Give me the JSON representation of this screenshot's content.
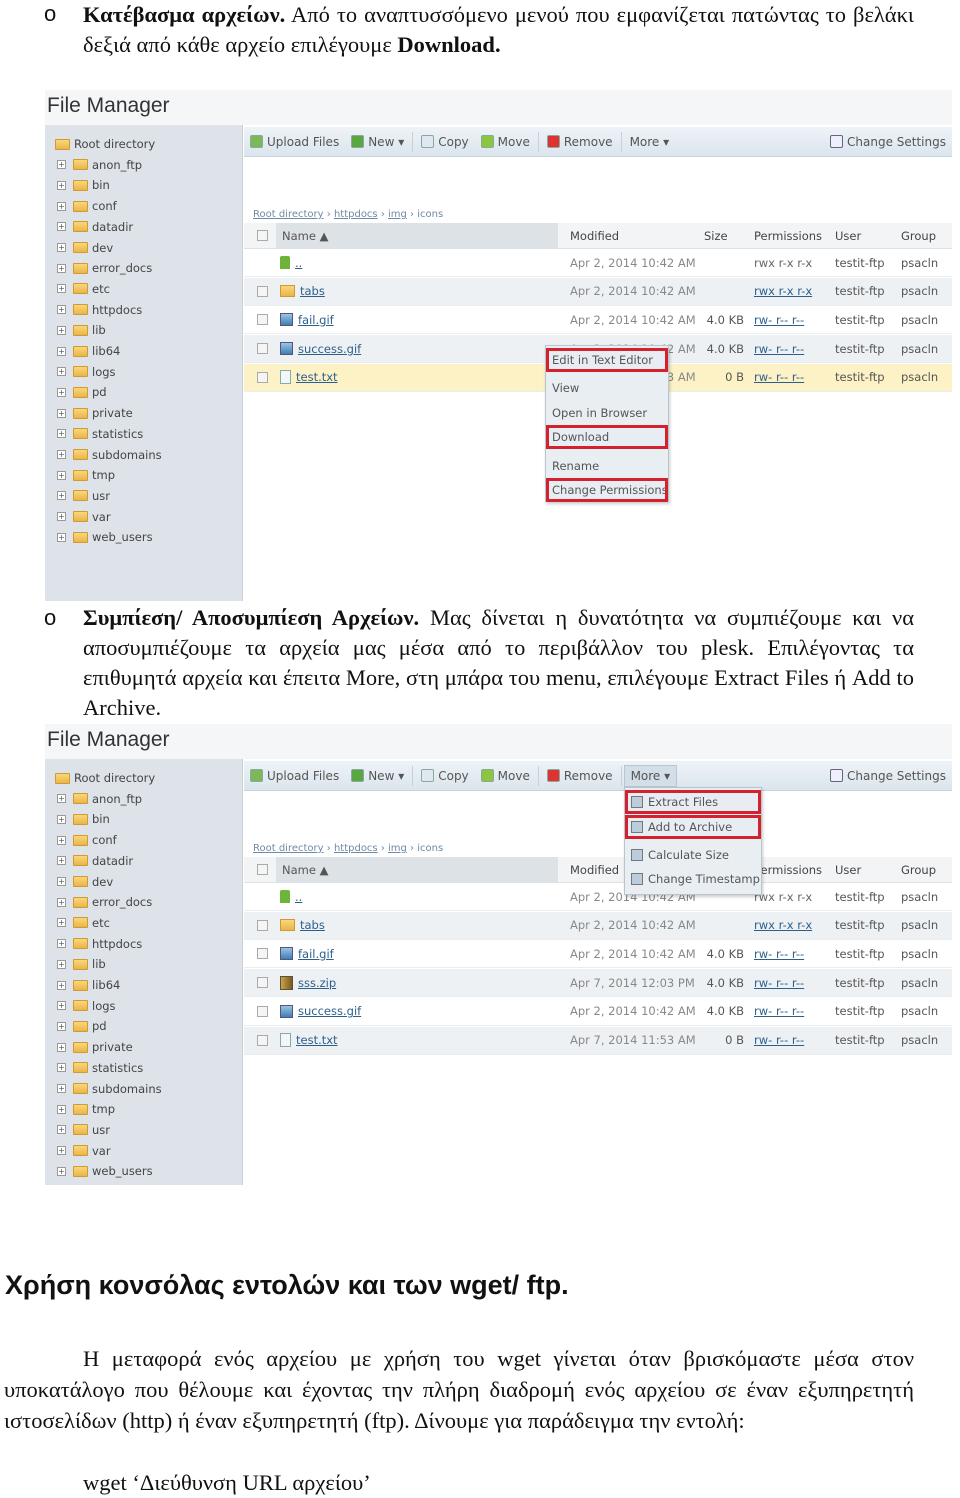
{
  "section1": {
    "bullet": "o",
    "title": "Κατέβασμα αρχείων.",
    "text": " Από το αναπτυσσόμενο μενού που εμφανίζεται πατώντας το βελάκι δεξιά από κάθε αρχείο επιλέγουμε ",
    "bold_end": "Download."
  },
  "section2": {
    "bullet": "o",
    "title": "Συμπίεση/ Αποσυμπίεση Αρχείων.",
    "text": " Μας δίνεται η δυνατότητα να συμπιέζουμε και να αποσυμπιέζουμε τα αρχεία μας μέσα από το περιβάλλον του plesk. Επιλέγοντας τα επιθυμητά αρχεία και έπειτα More, στη μπάρα του menu, επιλέγουμε Extract Files ή Add to Archive."
  },
  "heading": "Χρήση κονσόλας εντολών και των wget/ ftp.",
  "paragraph": "Η μεταφορά ενός αρχείου με χρήση του wget γίνεται όταν βρισκόμαστε μέσα στον υποκατάλογο που θέλουμε και έχοντας την πλήρη διαδρομή ενός αρχείου σε έναν εξυπηρετητή ιστοσελίδων (http) ή έναν εξυπηρετητή (ftp). Δίνουμε για παράδειγμα την εντολή:",
  "command": "wget ‘Διεύθυνση URL αρχείου’",
  "fm": {
    "title": "File Manager",
    "tree_root": "Root directory",
    "tree": [
      "anon_ftp",
      "bin",
      "conf",
      "datadir",
      "dev",
      "error_docs",
      "etc",
      "httpdocs",
      "lib",
      "lib64",
      "logs",
      "pd",
      "private",
      "statistics",
      "subdomains",
      "tmp",
      "usr",
      "var",
      "web_users"
    ],
    "toolbar": {
      "upload": "Upload Files",
      "new": "New ▾",
      "copy": "Copy",
      "move": "Move",
      "remove": "Remove",
      "more": "More ▾",
      "settings": "Change Settings"
    },
    "breadcrumb": [
      "Root directory",
      "httpdocs",
      "img",
      "icons"
    ],
    "columns": {
      "name": "Name ▲",
      "modified": "Modified",
      "size": "Size",
      "permissions": "Permissions",
      "user": "User",
      "group": "Group"
    },
    "colors": {
      "highlight": "#d3222d",
      "selected_row": "#fcf2c6"
    }
  },
  "fm1": {
    "rows": [
      {
        "icon": "up-arrow",
        "name": "..",
        "modified": "Apr 2, 2014 10:42 AM",
        "size": "",
        "perm": "rwx r-x r-x",
        "user": "testit-ftp",
        "group": "psacln",
        "check": false
      },
      {
        "icon": "folder",
        "name": "tabs",
        "modified": "Apr 2, 2014 10:42 AM",
        "size": "",
        "perm": "rwx r-x r-x",
        "user": "testit-ftp",
        "group": "psacln",
        "check": true
      },
      {
        "icon": "image",
        "name": "fail.gif",
        "modified": "Apr 2, 2014 10:42 AM",
        "size": "4.0 KB",
        "perm": "rw- r-- r--",
        "user": "testit-ftp",
        "group": "psacln",
        "check": true
      },
      {
        "icon": "image",
        "name": "success.gif",
        "modified": "Apr 2, 2014 10:42 AM",
        "size": "4.0 KB",
        "perm": "rw- r-- r--",
        "user": "testit-ftp",
        "group": "psacln",
        "check": true
      },
      {
        "icon": "text-file",
        "name": "test.txt",
        "modified": "Apr 7, 2014 11:53 AM",
        "size": "0 B",
        "perm": "rw- r-- r--",
        "user": "testit-ftp",
        "group": "psacln",
        "check": true,
        "selected": true
      }
    ],
    "menu": [
      {
        "label": "Edit in Text Editor",
        "highlight": true
      },
      {
        "label": "View"
      },
      {
        "label": "Open in Browser"
      },
      {
        "label": "Download",
        "highlight": true
      },
      {
        "label": "Rename"
      },
      {
        "label": "Change Permissions",
        "highlight": true
      }
    ]
  },
  "fm2": {
    "rows": [
      {
        "icon": "up-arrow",
        "name": "..",
        "modified": "Apr 2, 2014 10:42 AM",
        "size": "",
        "perm": "rwx r-x r-x",
        "user": "testit-ftp",
        "group": "psacln",
        "check": false
      },
      {
        "icon": "folder",
        "name": "tabs",
        "modified": "Apr 2, 2014 10:42 AM",
        "size": "",
        "perm": "rwx r-x r-x",
        "user": "testit-ftp",
        "group": "psacln",
        "check": true
      },
      {
        "icon": "image",
        "name": "fail.gif",
        "modified": "Apr 2, 2014 10:42 AM",
        "size": "4.0 KB",
        "perm": "rw- r-- r--",
        "user": "testit-ftp",
        "group": "psacln",
        "check": true
      },
      {
        "icon": "archive",
        "name": "sss.zip",
        "modified": "Apr 7, 2014 12:03 PM",
        "size": "4.0 KB",
        "perm": "rw- r-- r--",
        "user": "testit-ftp",
        "group": "psacln",
        "check": true
      },
      {
        "icon": "image",
        "name": "success.gif",
        "modified": "Apr 2, 2014 10:42 AM",
        "size": "4.0 KB",
        "perm": "rw- r-- r--",
        "user": "testit-ftp",
        "group": "psacln",
        "check": true
      },
      {
        "icon": "text-file",
        "name": "test.txt",
        "modified": "Apr 7, 2014 11:53 AM",
        "size": "0 B",
        "perm": "rw- r-- r--",
        "user": "testit-ftp",
        "group": "psacln",
        "check": true
      }
    ],
    "menu": [
      {
        "label": "Extract Files",
        "highlight": true,
        "icon": "extract"
      },
      {
        "label": "Add to Archive",
        "highlight": true,
        "icon": "archive"
      },
      {
        "label": "Calculate Size",
        "icon": "calculator"
      },
      {
        "label": "Change Timestamp",
        "icon": "clock"
      }
    ]
  }
}
